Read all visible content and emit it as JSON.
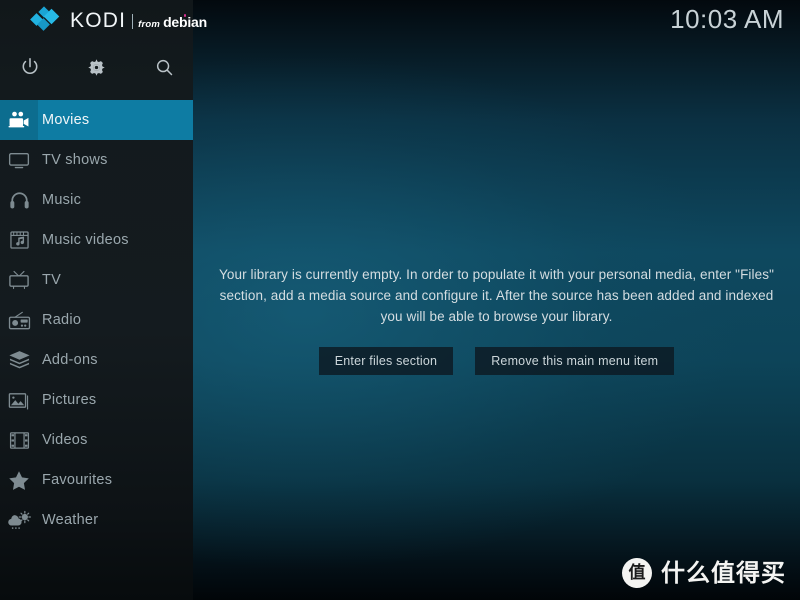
{
  "branding": {
    "logo_icon": "kodi-diamond-logo",
    "name": "KODI",
    "from_label": "from",
    "distro": "debian"
  },
  "toolbar": {
    "items": [
      {
        "name": "power-icon",
        "label": "Power"
      },
      {
        "name": "gear-icon",
        "label": "Settings"
      },
      {
        "name": "search-icon",
        "label": "Search"
      }
    ]
  },
  "sidebar": {
    "items": [
      {
        "label": "Movies",
        "icon": "movie-camera-icon",
        "selected": true
      },
      {
        "label": "TV shows",
        "icon": "monitor-icon",
        "selected": false
      },
      {
        "label": "Music",
        "icon": "headphones-icon",
        "selected": false
      },
      {
        "label": "Music videos",
        "icon": "film-music-icon",
        "selected": false
      },
      {
        "label": "TV",
        "icon": "television-icon",
        "selected": false
      },
      {
        "label": "Radio",
        "icon": "radio-icon",
        "selected": false
      },
      {
        "label": "Add-ons",
        "icon": "open-box-icon",
        "selected": false
      },
      {
        "label": "Pictures",
        "icon": "photo-icon",
        "selected": false
      },
      {
        "label": "Videos",
        "icon": "film-strip-icon",
        "selected": false
      },
      {
        "label": "Favourites",
        "icon": "star-icon",
        "selected": false
      },
      {
        "label": "Weather",
        "icon": "weather-cloud-sun-icon",
        "selected": false
      }
    ]
  },
  "header": {
    "clock": "10:03 AM"
  },
  "main": {
    "empty_message": "Your library is currently empty. In order to populate it with your personal media, enter \"Files\" section, add a media source and configure it. After the source has been added and indexed you will be able to browse your library.",
    "buttons": [
      {
        "label": "Enter files section"
      },
      {
        "label": "Remove this main menu item"
      }
    ]
  },
  "watermark": {
    "badge": "值",
    "text": "什么值得买"
  },
  "colors": {
    "accent_highlight": "#0e7ca3",
    "sidebar_bg": "#141b1f",
    "background_teal": "#0e485f",
    "logo_blue": "#21b2e0",
    "debian_dot": "#d7328f"
  }
}
